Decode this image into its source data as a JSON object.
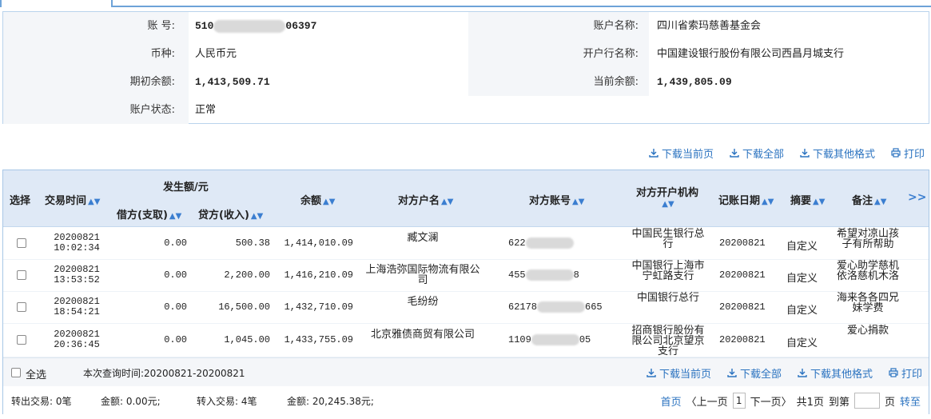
{
  "account": {
    "no_label": "账      号:",
    "no_prefix": "510",
    "no_suffix": "06397",
    "name_label": "账户名称:",
    "name_value": "四川省索玛慈善基金会",
    "currency_label": "币种:",
    "currency_value": "人民币元",
    "bank_label": "开户行名称:",
    "bank_value": "中国建设银行股份有限公司西昌月城支行",
    "open_bal_label": "期初余额:",
    "open_bal_value": "1,413,509.71",
    "cur_bal_label": "当前余额:",
    "cur_bal_value": "1,439,805.09",
    "status_label": "账户状态:",
    "status_value": "正常"
  },
  "toolbar": {
    "download_current": "下载当前页",
    "download_all": "下载全部",
    "download_other": "下载其他格式",
    "print": "打印"
  },
  "table": {
    "headers": {
      "select": "选择",
      "time": "交易时间",
      "amount_group": "发生额/元",
      "debit": "借方(支取)",
      "credit": "贷方(收入)",
      "balance": "余额",
      "payee_name": "对方户名",
      "payee_account": "对方账号",
      "payee_bank": "对方开户机构",
      "post_date": "记账日期",
      "summary": "摘要",
      "remark": "备注",
      "more": ">>"
    },
    "rows": [
      {
        "date": "20200821",
        "time": "10:02:34",
        "debit": "0.00",
        "credit": "500.38",
        "balance": "1,414,010.09",
        "payee": "臧文澜",
        "acct_prefix": "622",
        "acct_suffix": "",
        "bank": "中国民生银行总行",
        "post_date": "20200821",
        "summary": "自定义",
        "remark": "希望对凉山孩子有所帮助"
      },
      {
        "date": "20200821",
        "time": "13:53:52",
        "debit": "0.00",
        "credit": "2,200.00",
        "balance": "1,416,210.09",
        "payee": "上海浩弥国际物流有限公司",
        "acct_prefix": "455",
        "acct_suffix": "8",
        "bank": "中国银行上海市宁虹路支行",
        "post_date": "20200821",
        "summary": "自定义",
        "remark": "爱心助学慈机依洛慈机木洛"
      },
      {
        "date": "20200821",
        "time": "18:54:21",
        "debit": "0.00",
        "credit": "16,500.00",
        "balance": "1,432,710.09",
        "payee": "毛纷纷",
        "acct_prefix": "62178",
        "acct_suffix": "665",
        "bank": "中国银行总行",
        "post_date": "20200821",
        "summary": "自定义",
        "remark": "海来各各四兄妹学费"
      },
      {
        "date": "20200821",
        "time": "20:36:45",
        "debit": "0.00",
        "credit": "1,045.00",
        "balance": "1,433,755.09",
        "payee": "北京雅债商贸有限公司",
        "acct_prefix": "1109",
        "acct_suffix": "05",
        "bank": "招商银行股份有限公司北京望京支行",
        "post_date": "20200821",
        "summary": "自定义",
        "remark": "爱心捐款"
      }
    ]
  },
  "footer": {
    "select_all": "全选",
    "query_time": "本次查询时间:20200821-20200821",
    "out_trans": "转出交易: 0笔",
    "out_amount": "金额: 0.00元;",
    "in_trans": "转入交易: 4笔",
    "in_amount": "金额: 20,245.38元;",
    "pager": {
      "first": "首页",
      "prev": "〈上一页",
      "page": "1",
      "next": "下一页〉",
      "total": "共1页",
      "goto": "到第",
      "page_unit": "页",
      "go": "转至"
    }
  }
}
